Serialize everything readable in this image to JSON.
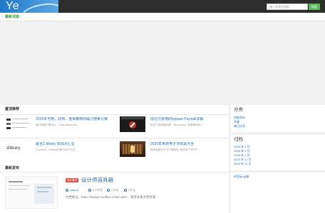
{
  "header": {
    "logo_text": "Ye",
    "search_placeholder": "输入关键字搜索",
    "search_button": "搜索"
  },
  "news": {
    "label": "最新消息："
  },
  "recommend": {
    "title": "置顶推荐",
    "items": [
      {
        "title": "2025年可用、好用、值得推荐的磁力搜索引擎",
        "desc": "磁力搜索引擎可以... https://btsol.net/ ...",
        "thumb": "search-list-thumbnail"
      },
      {
        "title": "绕过付费墙的bypass Paywall详解",
        "desc": "绕过付费墙指的是... Bloomberg, 财新等网站...",
        "thumb": "bypass-paywall-thumbnail"
      },
      {
        "title": "最全Z-library 资源大汇总",
        "desc": "Z-Access, Z-library的替代访问方式...",
        "thumb": "zlibrary-thumbnail"
      },
      {
        "title": "2025年免费电子书资源大全",
        "desc": "提供免费电子书下载网站, 免费电子书PDF...",
        "thumb": "library-thumbnail"
      }
    ],
    "zlib_logo": "zlibrary"
  },
  "latest": {
    "title": "最新发布",
    "post": {
      "badge": "设计素材",
      "title": "设计师道具箱",
      "author": "joseph",
      "time": "9小时前",
      "views": "0浏览",
      "comments": "0评论",
      "desc": "文档地址：https://design-toolbox.notion.site/... 更多优质文档资源"
    }
  },
  "sidebar": {
    "category": {
      "title": "分类",
      "links": [
        "技能资料",
        "资源",
        "每日分享"
      ]
    },
    "archive": {
      "title": "归档",
      "links": [
        "2025 年 3 月",
        "2025 年 2 月",
        "2025 年 1 月",
        "2024 年 12 月",
        "2024 年 11 月"
      ]
    },
    "extra": {
      "link": "阿里云/云服"
    }
  },
  "colors": {
    "accent_blue": "#2a6db0",
    "accent_green": "#5cb85c",
    "badge_red": "#e74c3c",
    "topbar": "#2d2d2d"
  }
}
